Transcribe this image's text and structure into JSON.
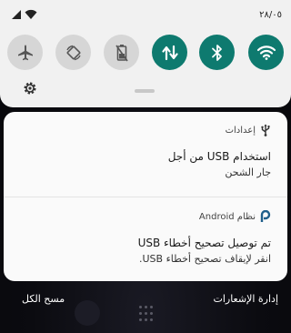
{
  "status_bar": {
    "time": "٢٨/٠٥"
  },
  "quick_settings": {
    "tiles": [
      {
        "icon": "wifi-icon",
        "state": "on"
      },
      {
        "icon": "bluetooth-icon",
        "state": "on"
      },
      {
        "icon": "mobile-data-icon",
        "state": "on"
      },
      {
        "icon": "battery-saver-icon",
        "state": "off"
      },
      {
        "icon": "auto-rotate-icon",
        "state": "off"
      },
      {
        "icon": "airplane-icon",
        "state": "off"
      }
    ]
  },
  "notifications": [
    {
      "app_name": "إعدادات",
      "icon": "usb-icon",
      "title": "استخدام USB من أجل",
      "text": "جار الشحن"
    },
    {
      "app_name": "نظام Android",
      "icon": "android-system-icon",
      "title": "تم توصيل تصحيح أخطاء USB",
      "text": "انقر لإيقاف تصحيح أخطاء USB."
    }
  ],
  "bottom_bar": {
    "manage_label": "إدارة الإشعارات",
    "clear_label": "مسح الكل"
  },
  "colors": {
    "tile_on": "#0e7a6f",
    "tile_off": "#d6d6d6",
    "panel": "#f1f1f1",
    "card": "#fafafa"
  }
}
